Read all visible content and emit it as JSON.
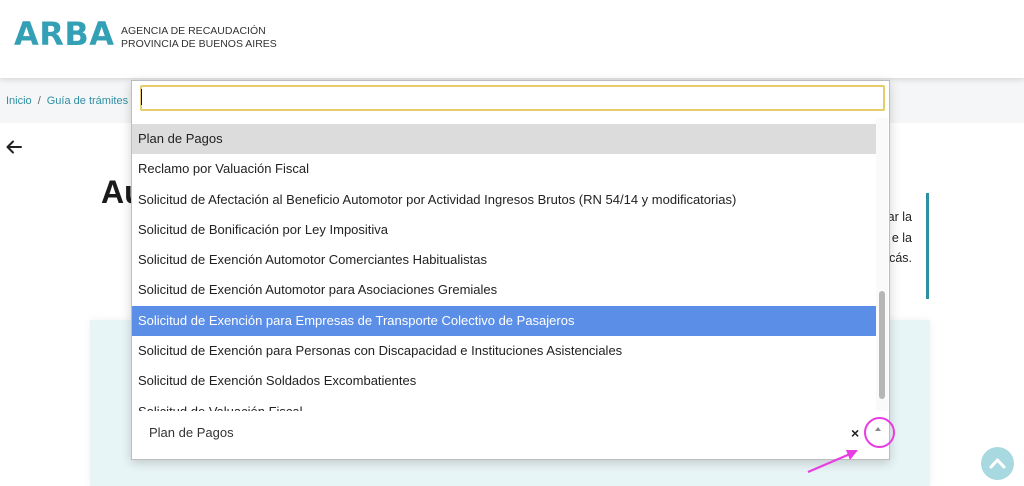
{
  "header": {
    "logo": "ARBA",
    "agency_line1": "AGENCIA DE RECAUDACIÓN",
    "agency_line2": "PROVINCIA DE BUENOS AIRES"
  },
  "breadcrumb": {
    "items": [
      "Inicio",
      "Guía de trámites"
    ],
    "separator": "/"
  },
  "page": {
    "title_fragment": "Au",
    "right_text": [
      "ar la",
      "e la",
      "cás."
    ]
  },
  "dropdown": {
    "search_value": "",
    "options": [
      {
        "label": "Plan de Pagos"
      },
      {
        "label": "Reclamo por Valuación Fiscal"
      },
      {
        "label": "Solicitud de Afectación al Beneficio Automotor por Actividad Ingresos Brutos (RN 54/14 y modificatorias)"
      },
      {
        "label": "Solicitud de Bonificación por Ley Impositiva"
      },
      {
        "label": "Solicitud de Exención Automotor Comerciantes Habitualistas"
      },
      {
        "label": "Solicitud de Exención Automotor para Asociaciones Gremiales"
      },
      {
        "label": "Solicitud de Exención para Empresas de Transporte Colectivo de Pasajeros"
      },
      {
        "label": "Solicitud de Exención para Personas con Discapacidad e Instituciones Asistenciales"
      },
      {
        "label": "Solicitud de Exención Soldados Excombatientes"
      },
      {
        "label": "Solicitud de Valuación Fiscal"
      }
    ],
    "selected_index": 0,
    "hover_index": 6,
    "current_value": "Plan de Pagos",
    "clear_symbol": "×"
  },
  "colors": {
    "brand": "#34a0b5",
    "hover": "#5b8ee6",
    "annotation": "#e83de3"
  },
  "icons": {
    "back": "arrow-left-icon",
    "toggle": "caret-up-icon",
    "scroll_top": "chevron-up-icon"
  }
}
